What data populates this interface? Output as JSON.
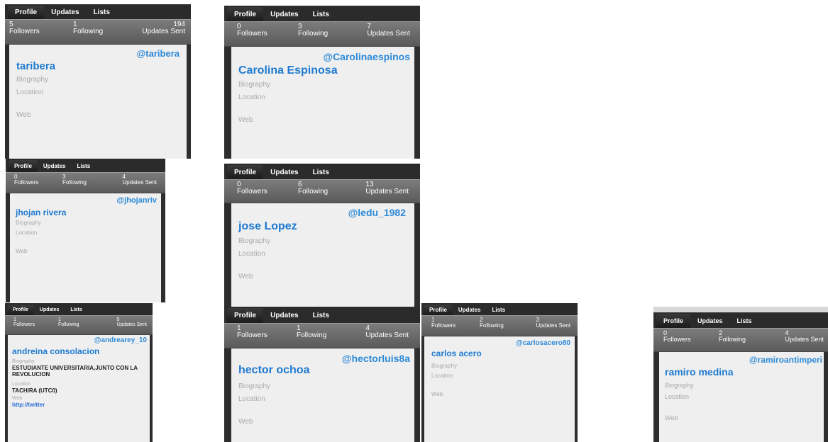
{
  "tabs": {
    "profile": "Profile",
    "updates": "Updates",
    "lists": "Lists"
  },
  "labels": {
    "followers": "Followers",
    "following": "Following",
    "updates_sent": "Updates Sent",
    "biography": "Biography",
    "location": "Location",
    "web": "Web"
  },
  "cards": [
    {
      "followers": "5",
      "following": "1",
      "updates": "194",
      "handle": "@taribera",
      "name": "taribera"
    },
    {
      "followers": "0",
      "following": "3",
      "updates": "7",
      "handle": "@Carolinaespinos",
      "name": "Carolina Espinosa"
    },
    {
      "followers": "0",
      "following": "3",
      "updates": "4",
      "handle": "@jhojanriv",
      "name": "jhojan rivera"
    },
    {
      "followers": "0",
      "following": "6",
      "updates": "13",
      "handle": "@ledu_1982",
      "name": "jose Lopez"
    },
    {
      "followers": "1",
      "following": "1",
      "updates": "5",
      "handle": "@andrearey_10",
      "name": "andreina consolacion",
      "bio_value": "ESTUDIANTE UNIVERSITARIA,JUNTO CON LA REVOLUCION",
      "location_value": "TACHIRA (UTC0)",
      "web_value": "http://twitter"
    },
    {
      "followers": "1",
      "following": "1",
      "updates": "4",
      "handle": "@hectorluis8a",
      "name": "hector ochoa"
    },
    {
      "followers": "1",
      "following": "2",
      "updates": "3",
      "handle": "@carlosacero80",
      "name": "carlos acero"
    },
    {
      "followers": "0",
      "following": "2",
      "updates": "4",
      "handle": "@ramiroantimperi",
      "name": "ramiro medina"
    }
  ]
}
